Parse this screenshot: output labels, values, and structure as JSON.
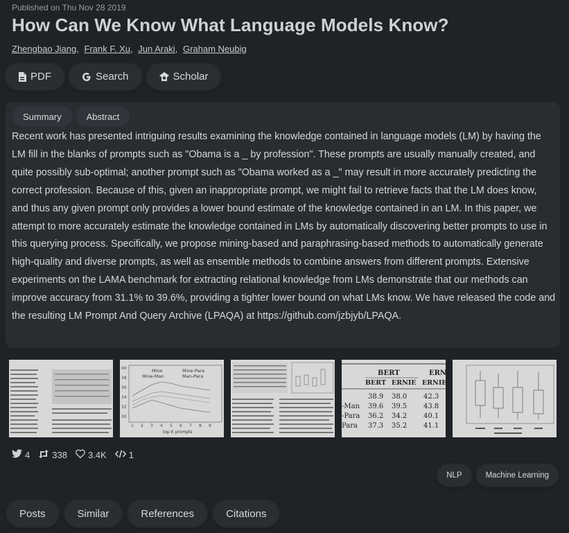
{
  "published": "Published on Thu Nov 28 2019",
  "title": "How Can We Know What Language Models Know?",
  "authors": [
    "Zhengbao Jiang",
    "Frank F. Xu",
    "Jun Araki",
    "Graham Neubig"
  ],
  "actions": {
    "pdf": "PDF",
    "search": "Search",
    "scholar": "Scholar"
  },
  "tabs": {
    "summary": "Summary",
    "abstract": "Abstract"
  },
  "abstract": "Recent work has presented intriguing results examining the knowledge contained in language models (LM) by having the LM fill in the blanks of prompts such as \"Obama is a _ by profession\". These prompts are usually manually created, and quite possibly sub-optimal; another prompt such as \"Obama worked as a _\" may result in more accurately predicting the correct profession. Because of this, given an inappropriate prompt, we might fail to retrieve facts that the LM does know, and thus any given prompt only provides a lower bound estimate of the knowledge contained in an LM. In this paper, we attempt to more accurately estimate the knowledge contained in LMs by automatically discovering better prompts to use in this querying process. Specifically, we propose mining-based and paraphrasing-based methods to automatically generate high-quality and diverse prompts, as well as ensemble methods to combine answers from different prompts. Extensive experiments on the LAMA benchmark for extracting relational knowledge from LMs demonstrate that our methods can improve accuracy from 31.1% to 39.6%, providing a tighter lower bound on what LMs know. We have released the code and the resulting LM Prompt And Query Archive (LPAQA) at https://github.com/jzbjyb/LPAQA.",
  "thumb_chart": {
    "legend": [
      "Mine",
      "Mine-Man",
      "Mine-Para",
      "Man-Para"
    ],
    "xlabel": "top K prompts",
    "yticks": [
      "40",
      "38",
      "36",
      "34",
      "32",
      "30"
    ],
    "xticks": [
      "1",
      "2",
      "3",
      "4",
      "5",
      "6",
      "7",
      "8",
      "9"
    ]
  },
  "thumb_table": {
    "headers": [
      "BERT",
      "ERN"
    ],
    "subheaders": [
      "BERT",
      "ERNIE",
      "ERNIE I"
    ],
    "rows": [
      {
        "label": "",
        "v1": "38.9",
        "v2": "38.0",
        "v3": "42.3"
      },
      {
        "label": "-Man",
        "v1": "39.6",
        "v2": "39.5",
        "v3": "43.8"
      },
      {
        "label": "-Para",
        "v1": "36.2",
        "v2": "34.2",
        "v3": "40.1"
      },
      {
        "label": "Para",
        "v1": "37.3",
        "v2": "35.2",
        "v3": "41.1"
      }
    ]
  },
  "stats": {
    "tweets": "4",
    "retweets": "338",
    "likes": "3.4K",
    "code": "1"
  },
  "tags": [
    "NLP",
    "Machine Learning"
  ],
  "bottom_tabs": [
    "Posts",
    "Similar",
    "References",
    "Citations"
  ],
  "colors": {
    "background": "#1f2226",
    "panel": "#292c31",
    "pill": "#2a2d32"
  }
}
